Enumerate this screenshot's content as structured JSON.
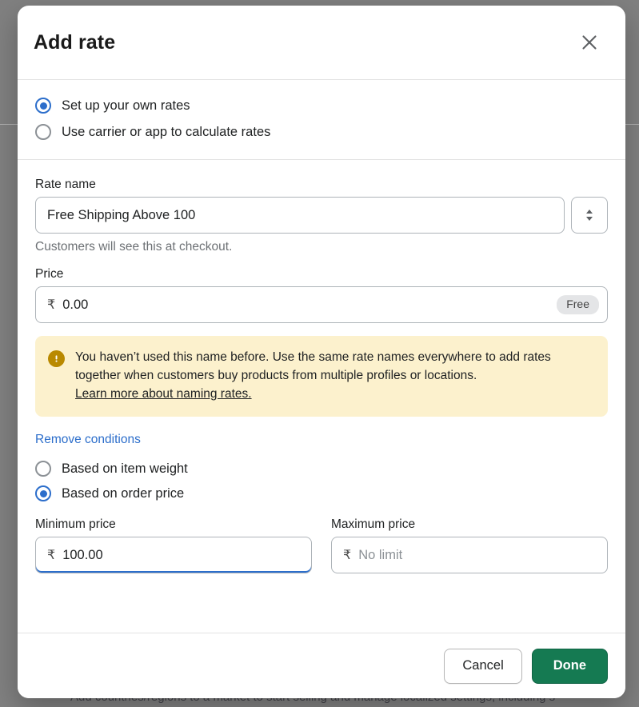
{
  "background": {
    "bottom_text": "Add countries/regions to a market to start selling and manage localized settings, including s",
    "right_column_fragments": "…"
  },
  "modal": {
    "title": "Add rate",
    "close_icon": "close-icon",
    "rate_type": {
      "options": [
        {
          "label": "Set up your own rates",
          "selected": true
        },
        {
          "label": "Use carrier or app to calculate rates",
          "selected": false
        }
      ]
    },
    "rate_name": {
      "label": "Rate name",
      "value": "Free Shipping Above 100",
      "placeholder": "Rate name",
      "help": "Customers will see this at checkout.",
      "stepper_icon": "chevron-up-down-icon"
    },
    "price": {
      "label": "Price",
      "currency_symbol": "₹",
      "value": "0.00",
      "badge": "Free"
    },
    "banner": {
      "icon": "warning-icon",
      "text": "You haven’t used this name before. Use the same rate names everywhere to add rates together when customers buy products from multiple profiles or locations.",
      "link": "Learn more about naming rates.",
      "background_color": "#fcf1cd",
      "icon_color": "#b98900"
    },
    "conditions": {
      "remove_link": "Remove conditions",
      "options": [
        {
          "label": "Based on item weight",
          "selected": false
        },
        {
          "label": "Based on order price",
          "selected": true
        }
      ],
      "minimum": {
        "label": "Minimum price",
        "currency_symbol": "₹",
        "value": "100.00",
        "placeholder": "0.00"
      },
      "maximum": {
        "label": "Maximum price",
        "currency_symbol": "₹",
        "value": "",
        "placeholder": "No limit"
      }
    },
    "footer": {
      "cancel_label": "Cancel",
      "done_label": "Done",
      "done_color": "#157a52"
    }
  }
}
